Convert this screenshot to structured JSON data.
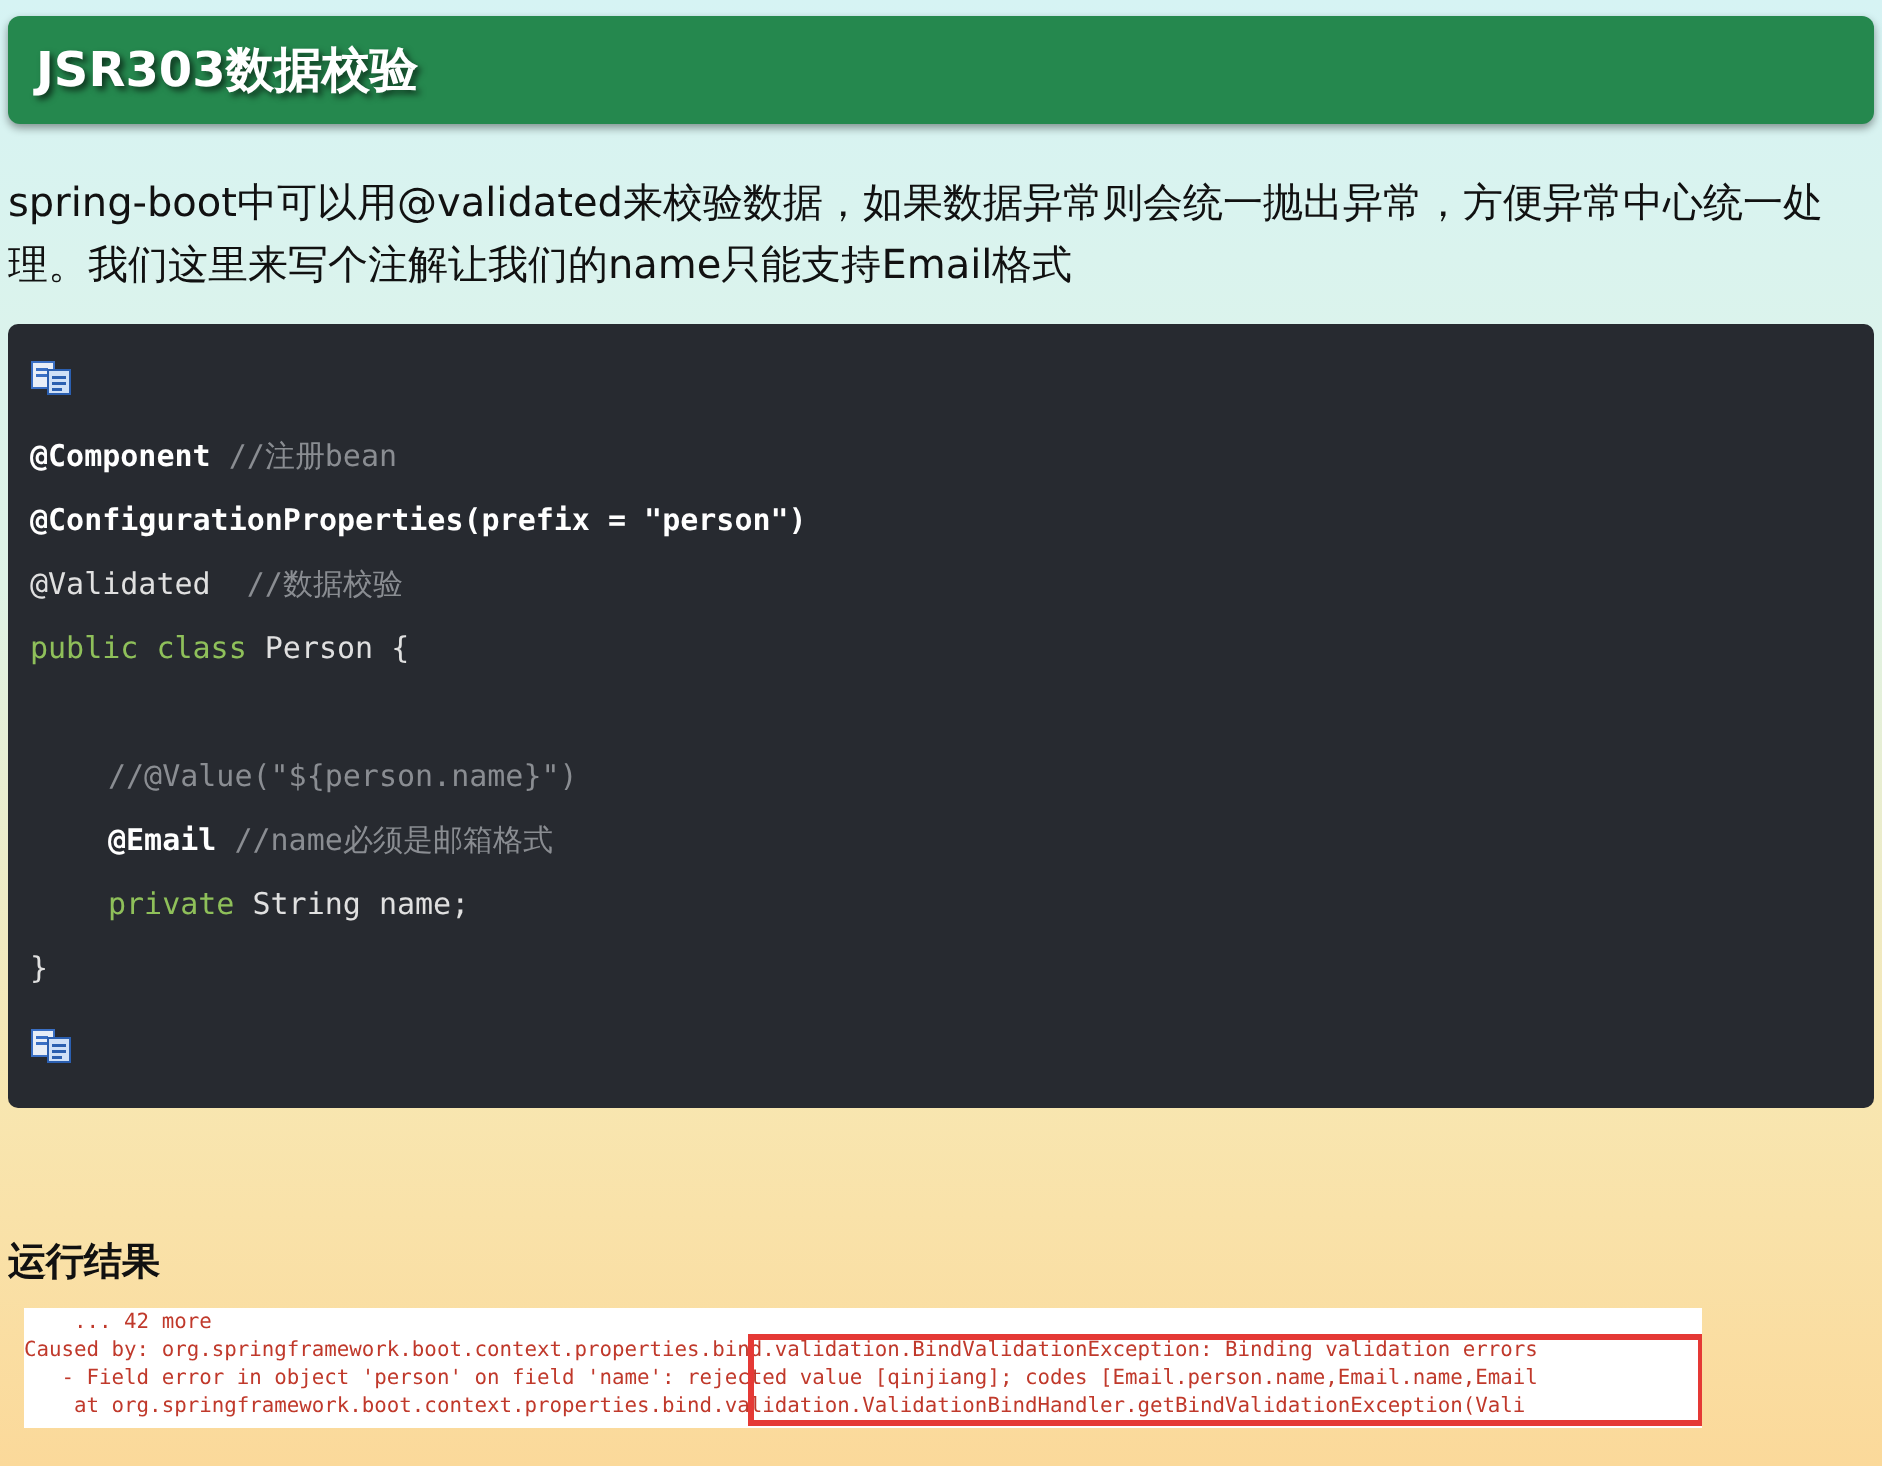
{
  "header": {
    "title": "JSR303数据校验"
  },
  "intro": "spring-boot中可以用@validated来校验数据，如果数据异常则会统一抛出异常，方便异常中心统一处理。我们这里来写个注解让我们的name只能支持Email格式",
  "code_block": {
    "lines": [
      {
        "kind": "code",
        "indented": false,
        "tokens": [
          {
            "kind": "annotation",
            "text": "@Component"
          },
          {
            "kind": "comment",
            "text": " //注册bean"
          }
        ]
      },
      {
        "kind": "code",
        "indented": false,
        "tokens": [
          {
            "kind": "annotation",
            "text": "@ConfigurationProperties(prefix = \"person\")"
          }
        ]
      },
      {
        "kind": "code",
        "indented": false,
        "tokens": [
          {
            "kind": "plain",
            "text": "@Validated"
          },
          {
            "kind": "comment",
            "text": "  //数据校验"
          }
        ]
      },
      {
        "kind": "code",
        "indented": false,
        "tokens": [
          {
            "kind": "keyword",
            "text": "public class"
          },
          {
            "kind": "plain",
            "text": " Person {"
          }
        ]
      },
      {
        "kind": "blank"
      },
      {
        "kind": "code",
        "indented": true,
        "tokens": [
          {
            "kind": "comment",
            "text": "//@Value(\"${person.name}\")"
          }
        ]
      },
      {
        "kind": "code",
        "indented": true,
        "tokens": [
          {
            "kind": "annotation",
            "text": "@Email"
          },
          {
            "kind": "comment",
            "text": " //name必须是邮箱格式"
          }
        ]
      },
      {
        "kind": "code",
        "indented": true,
        "tokens": [
          {
            "kind": "keyword",
            "text": "private"
          },
          {
            "kind": "plain",
            "text": " String name;"
          }
        ]
      },
      {
        "kind": "code",
        "indented": false,
        "tokens": [
          {
            "kind": "plain",
            "text": "}"
          }
        ]
      }
    ]
  },
  "result": {
    "heading": "运行结果",
    "console_lines": [
      "    ... 42 more",
      "Caused by: org.springframework.boot.context.properties.bind.validation.BindValidationException: Binding validation errors",
      "   - Field error in object 'person' on field 'name': rejected value [qinjiang]; codes [Email.person.name,Email.name,Email",
      "    at org.springframework.boot.context.properties.bind.validation.ValidationBindHandler.getBindValidationException(Vali"
    ]
  }
}
